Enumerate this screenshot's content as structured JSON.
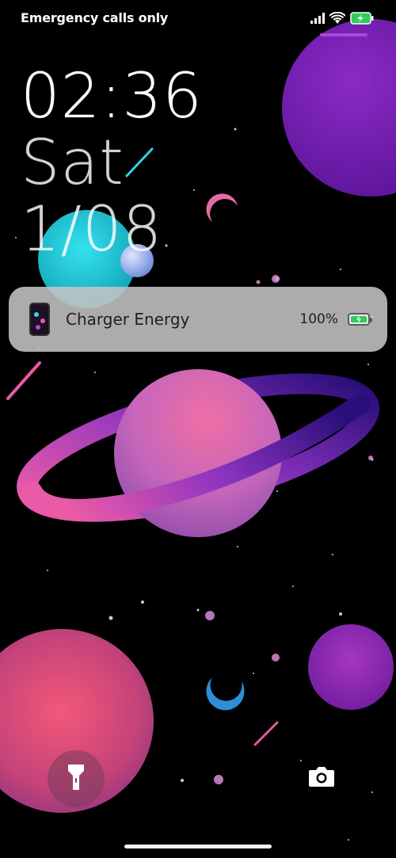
{
  "status_bar": {
    "carrier_text": "Emergency calls only",
    "icons": [
      "signal-icon",
      "wifi-icon",
      "battery-charging-icon"
    ],
    "battery_color": "#2ecc5b"
  },
  "lockscreen": {
    "time": "02:36",
    "day": "Sat",
    "date": "1/08"
  },
  "notification": {
    "app_icon": "charger-energy-app-icon",
    "title": "Charger Energy",
    "percent": "100%",
    "battery_icon": "battery-charging-icon"
  },
  "shortcuts": {
    "left": "flashlight-icon",
    "right": "camera-icon"
  },
  "colors": {
    "accent": "#a54cd6",
    "notification_bg": "#c4c4c4"
  }
}
